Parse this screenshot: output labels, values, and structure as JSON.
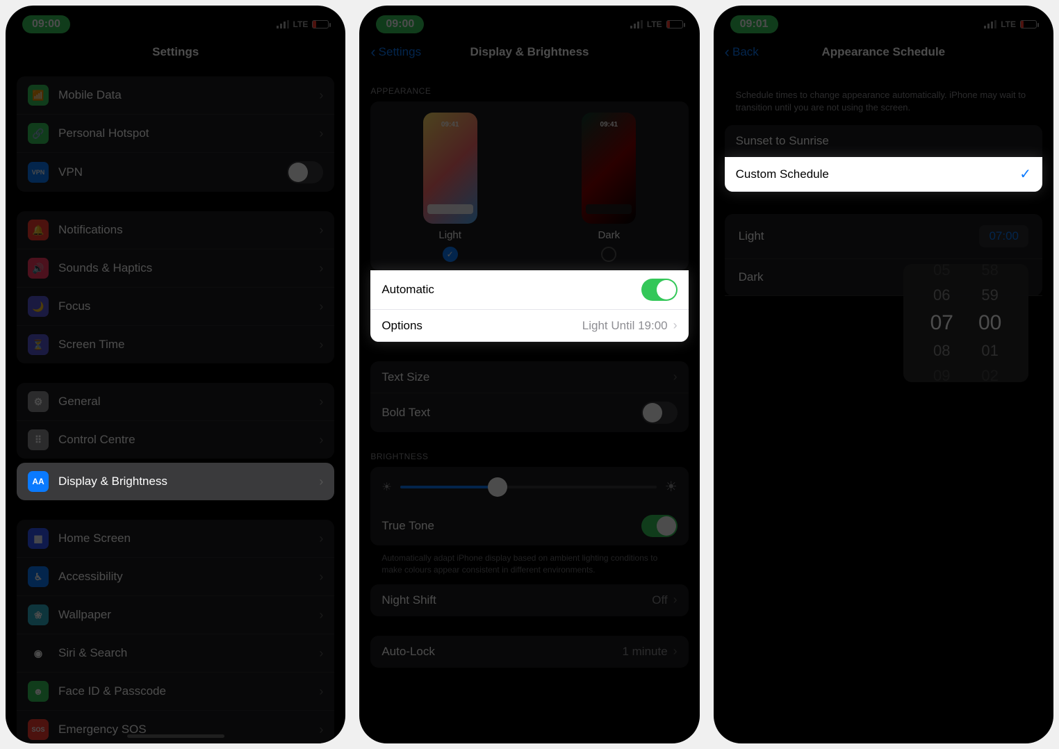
{
  "screen1": {
    "time": "09:00",
    "network": "LTE",
    "title": "Settings",
    "items": [
      {
        "key": "mobile-data",
        "label": "Mobile Data",
        "color": "#34c759",
        "icon": "📶"
      },
      {
        "key": "hotspot",
        "label": "Personal Hotspot",
        "color": "#34c759",
        "icon": "🔗"
      },
      {
        "key": "vpn",
        "label": "VPN",
        "color": "#0a7aff",
        "icon": "VPN",
        "toggle": false
      },
      {
        "key": "notifications",
        "label": "Notifications",
        "color": "#ff3b30",
        "icon": "🔔"
      },
      {
        "key": "sounds",
        "label": "Sounds & Haptics",
        "color": "#ff375f",
        "icon": "🔊"
      },
      {
        "key": "focus",
        "label": "Focus",
        "color": "#5856d6",
        "icon": "🌙"
      },
      {
        "key": "screentime",
        "label": "Screen Time",
        "color": "#5856d6",
        "icon": "⏳"
      },
      {
        "key": "general",
        "label": "General",
        "color": "#8e8e93",
        "icon": "⚙︎"
      },
      {
        "key": "control-centre",
        "label": "Control Centre",
        "color": "#8e8e93",
        "icon": "⠿"
      },
      {
        "key": "display",
        "label": "Display & Brightness",
        "color": "#0a7aff",
        "icon": "AA",
        "selected": true
      },
      {
        "key": "home",
        "label": "Home Screen",
        "color": "#3355ff",
        "icon": "▦"
      },
      {
        "key": "accessibility",
        "label": "Accessibility",
        "color": "#0a7aff",
        "icon": "♿︎"
      },
      {
        "key": "wallpaper",
        "label": "Wallpaper",
        "color": "#30b0c7",
        "icon": "❀"
      },
      {
        "key": "siri",
        "label": "Siri & Search",
        "color": "#1c1c1e",
        "icon": "◉"
      },
      {
        "key": "faceid",
        "label": "Face ID & Passcode",
        "color": "#34c759",
        "icon": "☻"
      },
      {
        "key": "sos",
        "label": "Emergency SOS",
        "color": "#ff3b30",
        "icon": "SOS"
      }
    ]
  },
  "screen2": {
    "time": "09:00",
    "network": "LTE",
    "back": "Settings",
    "title": "Display & Brightness",
    "appearance_header": "APPEARANCE",
    "light_label": "Light",
    "dark_label": "Dark",
    "thumb_time": "09:41",
    "automatic_label": "Automatic",
    "automatic_on": true,
    "options_label": "Options",
    "options_value": "Light Until 19:00",
    "textsize_label": "Text Size",
    "bold_label": "Bold Text",
    "bold_on": false,
    "brightness_header": "BRIGHTNESS",
    "truetone_label": "True Tone",
    "truetone_on": true,
    "truetone_help": "Automatically adapt iPhone display based on ambient lighting conditions to make colours appear consistent in different environments.",
    "nightshift_label": "Night Shift",
    "nightshift_value": "Off",
    "autolock_label": "Auto-Lock",
    "autolock_value": "1 minute"
  },
  "screen3": {
    "time": "09:01",
    "network": "LTE",
    "back": "Back",
    "title": "Appearance Schedule",
    "help": "Schedule times to change appearance automatically. iPhone may wait to transition until you are not using the screen.",
    "opt_sunset": "Sunset to Sunrise",
    "opt_custom": "Custom Schedule",
    "light_label": "Light",
    "light_time": "07:00",
    "dark_label": "Dark",
    "wheel_hours": [
      "05",
      "06",
      "07",
      "08",
      "09"
    ],
    "wheel_mins": [
      "58",
      "59",
      "00",
      "01",
      "02"
    ]
  }
}
